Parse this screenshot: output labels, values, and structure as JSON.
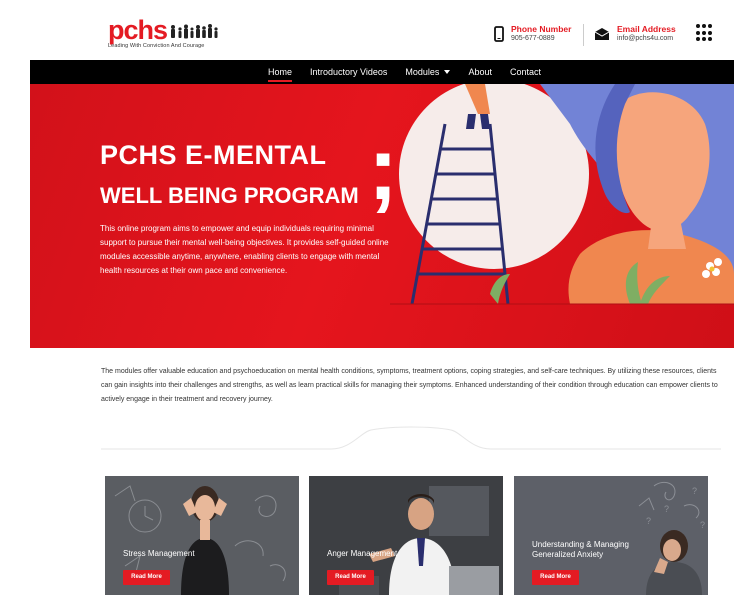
{
  "header": {
    "logo_text": "pchs",
    "logo_tagline": "Leading With Conviction And Courage",
    "phone": {
      "title": "Phone Number",
      "value": "905-677-0889",
      "icon": "phone-icon"
    },
    "email": {
      "title": "Email Address",
      "value": "info@pchs4u.com",
      "icon": "envelope-icon"
    },
    "menu_icon": "grid-menu-icon"
  },
  "nav": {
    "items": [
      {
        "label": "Home",
        "active": true
      },
      {
        "label": "Introductory Videos",
        "active": false
      },
      {
        "label": "Modules",
        "active": false,
        "has_dropdown": true
      },
      {
        "label": "About",
        "active": false
      },
      {
        "label": "Contact",
        "active": false
      }
    ]
  },
  "hero": {
    "title_line1": "PCHS E-MENTAL",
    "title_line2": "WELL BEING PROGRAM",
    "semicolon": ";",
    "description": "This online program aims to empower and equip individuals requiring minimal support to pursue their mental well-being objectives. It provides self-guided online modules accessible anytime, anywhere, enabling clients to engage with mental health resources at their own pace and convenience."
  },
  "intro": {
    "text": "The modules offer valuable education and psychoeducation on mental health conditions, symptoms, treatment options, coping strategies, and self-care techniques. By utilizing these resources, clients can gain insights into their challenges and strengths, as well as learn practical skills for managing their symptoms. Enhanced understanding of their condition through education can empower clients to actively engage in their treatment and recovery journey."
  },
  "cards": [
    {
      "title": "Stress Management",
      "button": "Read More"
    },
    {
      "title": "Anger Management",
      "button": "Read More"
    },
    {
      "title": "Understanding & Managing Generalized Anxiety",
      "button": "Read More"
    }
  ],
  "colors": {
    "brand_red": "#e41b23",
    "nav_bg": "#000000",
    "hero_blue": "#7283d6",
    "hero_orange": "#f0874f"
  }
}
